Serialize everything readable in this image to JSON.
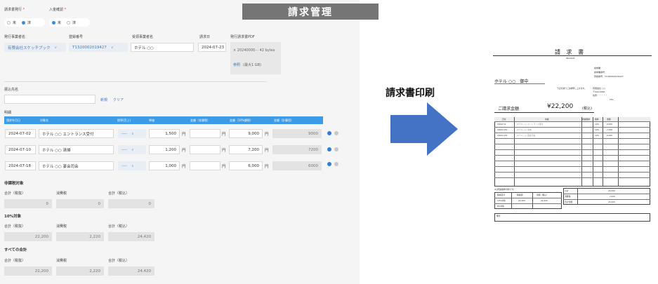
{
  "title_banner": "請求管理",
  "print_label": "請求書印刷",
  "form": {
    "invoice_issue_label": "請求書発行",
    "payment_confirm_label": "入金確認",
    "required_mark": "*",
    "radio_no": "未",
    "radio_done": "済",
    "issuer_label": "発行事業者名",
    "issuer_value": "有限会社スケッチブック",
    "reg_no_label": "登録番号",
    "reg_no_value": "T1320002019427",
    "recipient_label": "受領事業者名",
    "recipient_value": "ホテル ○○",
    "issue_date_label": "請求日",
    "issue_date_value": "2024-07-23",
    "pdf_label": "発行請求書PDF",
    "pdf_file": "× 20240000··· 42 bytes",
    "browse_link": "参照",
    "max_note": "(最大1 GB)",
    "payee_label": "振込先名",
    "new_link": "新規",
    "clear_link": "クリア",
    "detail_label": "明細",
    "table_headers": [
      "請求年月日",
      "対象名",
      "税率(売上)",
      "単価",
      "金額（非課税）",
      "金額（10%課税）",
      "金額（計算用）"
    ],
    "yen": "円",
    "rows": [
      {
        "date": "2024-07-02",
        "name": "ホテル ○○ エントランス受付",
        "tax": "----",
        "unit": "1,500",
        "nontax": "",
        "taxed": "9,000",
        "calc": "9000"
      },
      {
        "date": "2024-07-10",
        "name": "ホテル ○○ 清掃",
        "tax": "----",
        "unit": "1,200",
        "nontax": "",
        "taxed": "7,200",
        "calc": "7200"
      },
      {
        "date": "2024-07-18",
        "name": "ホテル ○○ 宴会司会",
        "tax": "----",
        "unit": "1,000",
        "nontax": "",
        "taxed": "6,000",
        "calc": "6000"
      }
    ],
    "nontax_section": "非課税対象",
    "sum_ex_label": "合計（税抜）",
    "tax_label": "消費税",
    "sum_in_label": "合計（税込）",
    "nontax_vals": [
      "0",
      "0",
      "0"
    ],
    "ten_section": "10%対象",
    "ten_vals": [
      "22,200",
      "2,220",
      "24,420"
    ],
    "all_section": "すべての合計",
    "all_vals": [
      "22,200",
      "2,220",
      "24,420"
    ]
  },
  "invoice": {
    "title": "請 求 書",
    "subtitle": "INVOICE",
    "meta": [
      "請求書：",
      "請求書番号：",
      "登録番号：T1320002019427"
    ],
    "client": "ホテル ○○　御中",
    "note": "下記の通りご請求申し上げます。",
    "issuer": [
      "有限会社 ○○",
      "〒000-0000",
      "住所・・・・・",
      "TEL："
    ],
    "amount_label": "ご請求金額",
    "amount": "¥22,200",
    "amount_suffix": "(税込)",
    "table_headers": [
      "日付",
      "内容",
      "軽減税率",
      "税率",
      "金額"
    ],
    "rows": [
      {
        "date": "2024/7/2",
        "desc": "ホテル ○○ エントランス受付",
        "rate": "10%",
        "amt": "9,000"
      },
      {
        "date": "2024/7/10",
        "desc": "ホテル ○○ 清掃",
        "rate": "10%",
        "amt": "7,200"
      },
      {
        "date": "2024/7/18",
        "desc": "ホテル ○○ 宴会司会",
        "rate": "10%",
        "amt": "6,000"
      }
    ],
    "reduced_note": "※は軽減税率対象です。",
    "sub_headers": [
      "税率区分",
      "税抜額",
      "金額（税込）"
    ],
    "sub_rows": [
      [
        "10%対象",
        "22,200",
        "24,420"
      ],
      [
        "8%対象",
        "",
        ""
      ]
    ],
    "totals": [
      [
        "小計",
        "22,200"
      ],
      [
        "消費税",
        "2,220"
      ],
      [
        "合計金額",
        "24,420"
      ]
    ],
    "remarks": "備考"
  }
}
